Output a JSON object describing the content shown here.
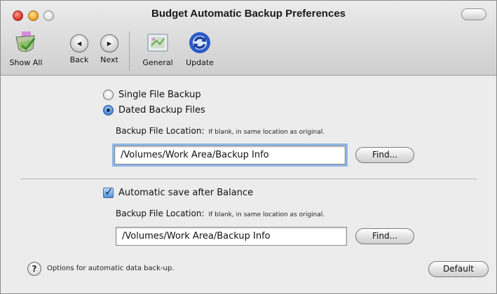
{
  "window": {
    "title": "Budget Automatic Backup Preferences"
  },
  "toolbar": {
    "items": [
      {
        "label": "Show All",
        "icon": "show-all-icon"
      },
      {
        "label": "Back",
        "icon": "back-arrow-icon"
      },
      {
        "label": "Next",
        "icon": "next-arrow-icon"
      },
      {
        "label": "General",
        "icon": "general-prefs-icon"
      },
      {
        "label": "Update",
        "icon": "update-sync-icon"
      }
    ]
  },
  "backup_mode": {
    "options": [
      {
        "label": "Single File Backup",
        "selected": false
      },
      {
        "label": "Dated Backup Files",
        "selected": true
      }
    ],
    "location_label": "Backup File Location:",
    "location_hint": "If blank, in same location as original.",
    "location_value": "/Volumes/Work Area/Backup Info",
    "find_label": "Find..."
  },
  "auto_save": {
    "checkbox_label": "Automatic save after Balance",
    "checked": true,
    "location_label": "Backup File Location:",
    "location_hint": "If blank, in same location as original.",
    "location_value": "/Volumes/Work Area/Backup Info",
    "find_label": "Find..."
  },
  "footer": {
    "help_glyph": "?",
    "status_text": "Options for automatic data back-up.",
    "default_label": "Default"
  }
}
